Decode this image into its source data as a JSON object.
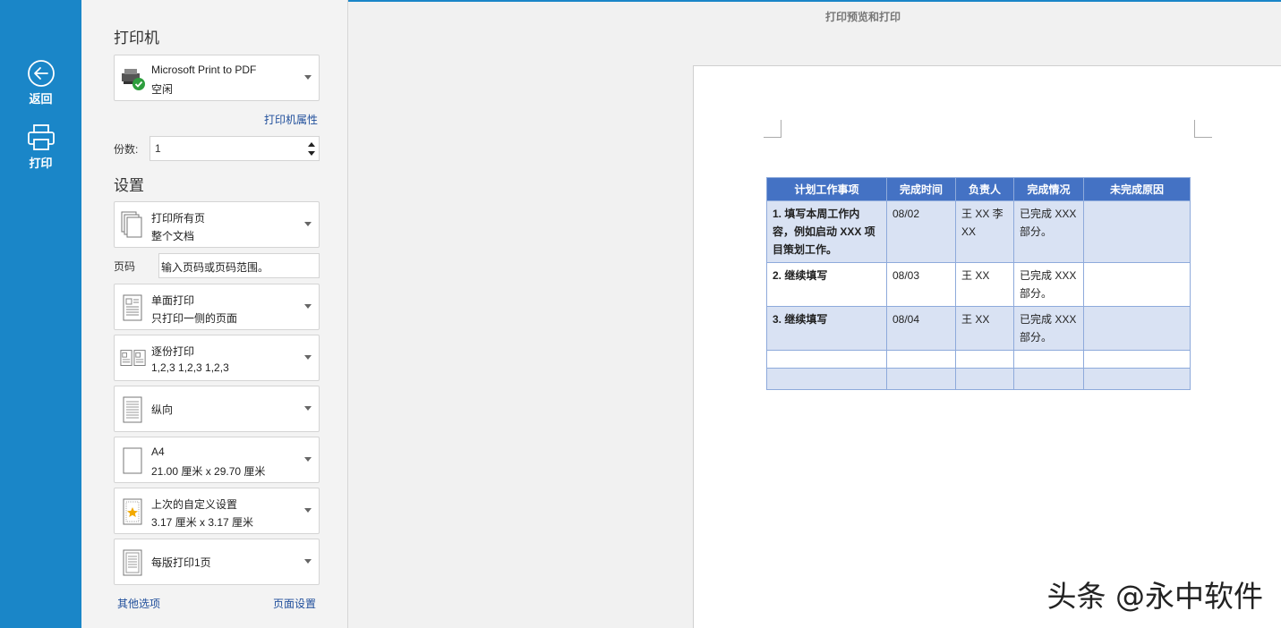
{
  "rail": {
    "back_label": "返回",
    "print_label": "打印",
    "color": "#1a86c8"
  },
  "printer": {
    "section_title": "打印机",
    "name": "Microsoft Print to PDF",
    "status": "空闲",
    "properties_link": "打印机属性",
    "copies_label": "份数:",
    "copies_value": "1"
  },
  "settings": {
    "section_title": "设置",
    "scope": {
      "line1": "打印所有页",
      "line2": "整个文档"
    },
    "pages_label": "页码",
    "pages_placeholder": "输入页码或页码范围。",
    "sides": {
      "line1": "单面打印",
      "line2": "只打印一侧的页面"
    },
    "collate": {
      "line1": "逐份打印",
      "line2": "1,2,3   1,2,3   1,2,3"
    },
    "orientation": {
      "line1": "纵向"
    },
    "paper": {
      "line1": "A4",
      "line2": "21.00 厘米 x 29.70 厘米"
    },
    "margins": {
      "line1": "上次的自定义设置",
      "line2": "3.17 厘米 x 3.17 厘米"
    },
    "per_sheet": {
      "line1": "每版打印1页"
    },
    "other_options_link": "其他选项",
    "page_setup_link": "页面设置"
  },
  "preview": {
    "title": "打印预览和打印",
    "table": {
      "headers": [
        "计划工作事项",
        "完成时间",
        "负责人",
        "完成情况",
        "未完成原因"
      ],
      "rows": [
        [
          "1. 填写本周工作内容，例如启动 XXX 项目策划工作。",
          "08/02",
          "王 XX 李 XX",
          "已完成 XXX 部分。",
          ""
        ],
        [
          "2. 继续填写",
          "08/03",
          "王 XX",
          "已完成 XXX 部分。",
          ""
        ],
        [
          "3. 继续填写",
          "08/04",
          "王 XX",
          "已完成 XXX 部分。",
          ""
        ],
        [
          "",
          "",
          "",
          "",
          ""
        ],
        [
          "",
          "",
          "",
          "",
          ""
        ]
      ],
      "header_color": "#4472c4",
      "band_color": "#d9e2f3"
    }
  },
  "watermark": "头条 @永中软件"
}
